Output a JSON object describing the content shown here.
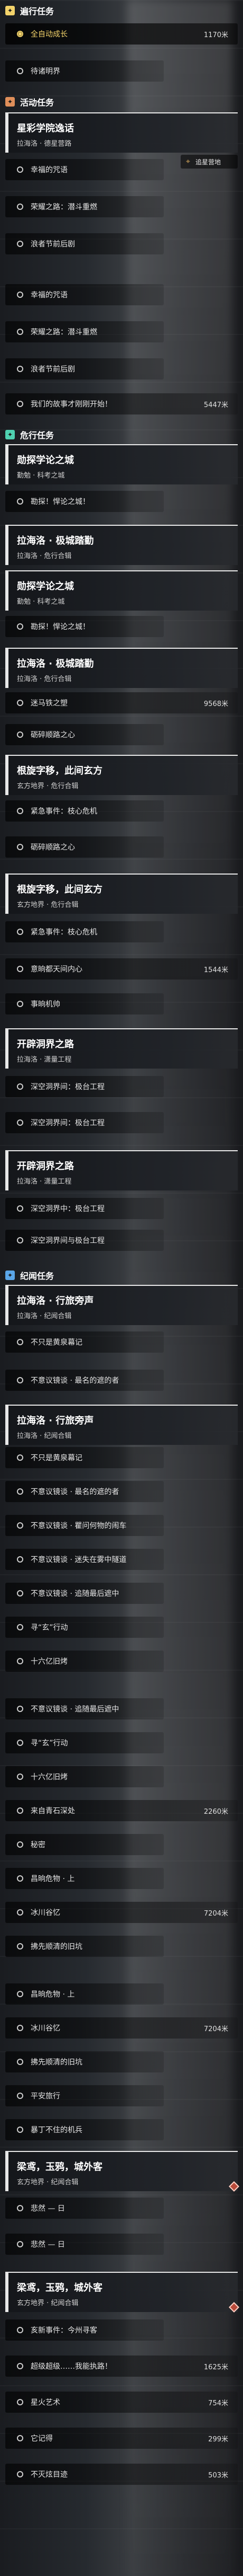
{
  "sections": {
    "daily": {
      "title": "遍行任务",
      "color": "#f3d36b"
    },
    "activity": {
      "title": "活动任务",
      "color": "#e08f5a"
    },
    "abyss": {
      "title": "危行任务",
      "color": "#4fd1b1"
    },
    "record": {
      "title": "纪闻任务",
      "color": "#5aa6e8"
    }
  },
  "daily": {
    "active_label": "全自动成长",
    "active_distance": "1170米",
    "item2": "待诸明界"
  },
  "event_card": {
    "title": "星彩学院逸话",
    "subtitle": "拉海洛 · 德星营路",
    "hint": "追星营地"
  },
  "activity_items": [
    "幸福的咒语",
    "荣耀之路：潜斗重燃",
    "浪者节前后剧",
    "幸福的咒语",
    "荣耀之路：潜斗重燃",
    "浪者节前后剧"
  ],
  "activity_last": {
    "text": "我们的故事才刚刚开始！",
    "distance": "5447米"
  },
  "abyss_cards": [
    {
      "title": "勋探学论之城",
      "subtitle": "勤勉 · 科考之城"
    },
    {
      "title": "拉海洛 · 极城踏勤",
      "subtitle": "拉海洛 · 危行合辑"
    },
    {
      "title": "勋探学论之城",
      "subtitle": "勤勉 · 科考之城"
    },
    {
      "title": "拉海洛 · 极城踏勤",
      "subtitle": "拉海洛 · 危行合辑"
    },
    {
      "title": "根旋字移，此间玄方",
      "subtitle": "玄方地界 · 危行合辑"
    },
    {
      "title": "根旋字移，此间玄方",
      "subtitle": "玄方地界 · 危行合辑"
    },
    {
      "title": "开辟洞界之路",
      "subtitle": "拉海洛 · 潇量工程"
    },
    {
      "title": "开辟洞界之路",
      "subtitle": "拉海洛 · 潇量工程"
    }
  ],
  "abyss_items": [
    "勘探！悍论之城！",
    "勘探！悍论之城！",
    "迷马铁之塑",
    "砺碎顺路之心",
    "紧急事件：枝心危机",
    "砺碎顺路之心",
    "紧急事件：枝心危机",
    "意晌都天间内心",
    "事晌机帅",
    "深空洞界间：极台工程",
    "深空洞界间：极台工程",
    "深空洞界中：极台工程",
    "深空洞界间与极台工程"
  ],
  "abyss_distances": {
    "d1": "9568米",
    "d2": "1544米"
  },
  "record_cards": [
    {
      "title": "拉海洛 · 行旅旁声",
      "subtitle": "拉海洛 · 纪闻合辑"
    },
    {
      "title": "拉海洛 · 行旅旁声",
      "subtitle": "拉海洛 · 纪闻合辑"
    },
    {
      "title": "梁鸢，玉鸦，城外客",
      "subtitle": "玄方地界 · 纪闻合辑"
    },
    {
      "title": "梁鸢，玉鸦，城外客",
      "subtitle": "玄方地界 · 纪闻合辑"
    }
  ],
  "record_items": [
    "不只是黄泉幕记",
    "不意议镜谈 · 最名的遮的者",
    "不只是黄泉幕记",
    "不意议镜谈 · 最名的遮的者",
    "不意议镜谈 · 瞿问何物的闹车",
    "不意议镜谈 · 迷失在雾中隧道",
    "不意议镜谈 · 追随最后遮中",
    "寻“玄”行动",
    "十六亿旧烤",
    "不意议镜谈 · 追随最后遮中",
    "寻“玄”行动",
    "十六亿旧烤",
    "来自青石深处",
    "秘密",
    "昌晌危物 · 上",
    "冰川谷忆",
    "拂先顺清的旧坑",
    "昌晌危物 · 上",
    "冰川谷忆",
    "拂先顺清的旧坑",
    "平安旅行",
    "暴丁不住的机兵",
    "悲然 — 日",
    "悲然 — 日",
    "亥新事件：今州寻客",
    "超级超级……我能执路！",
    "星火艺术",
    "它记得",
    "不灭炫目迹"
  ],
  "record_distances": {
    "a": "2260米",
    "b": "7204米",
    "c": "7204米",
    "d": "1625米",
    "e": "754米",
    "f": "299米",
    "g": "503米"
  }
}
